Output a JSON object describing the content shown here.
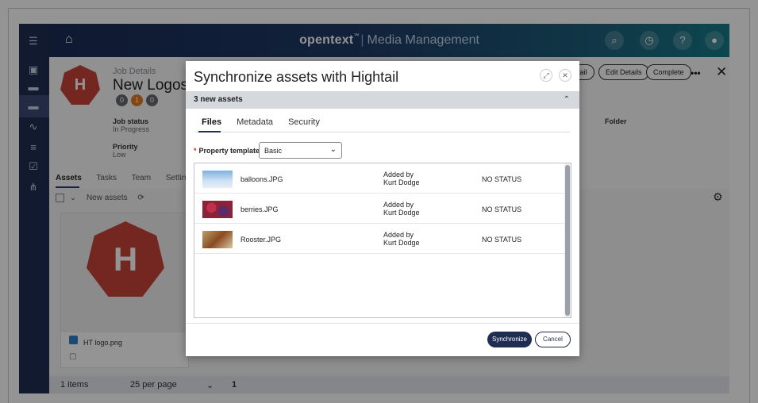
{
  "app": {
    "brand_name": "opentext",
    "brand_tm": "™",
    "brand_product": "Media Management"
  },
  "job": {
    "label": "Job Details",
    "title": "New Logos - F",
    "badges": [
      "0",
      "1",
      "0"
    ],
    "status_label": "Job status",
    "status_value": "In Progress",
    "priority_label": "Priority",
    "priority_value": "Low",
    "folder_label": "Folder",
    "header_buttons": [
      "tail",
      "Edit Details",
      "Complete"
    ],
    "more": "•••",
    "close": "✕"
  },
  "job_tabs": [
    "Assets",
    "Tasks",
    "Team",
    "Settings"
  ],
  "assets_toolbar": {
    "title": "New assets",
    "refresh": "⟳",
    "gear": "⚙"
  },
  "asset_card": {
    "name": "HT logo.png",
    "logo_letter": "H"
  },
  "pager": {
    "count": "1 items",
    "per_page": "25 per page",
    "page": "1"
  },
  "modal": {
    "title": "Synchronize assets with Hightail",
    "section_title": "3 new assets",
    "tabs": [
      "Files",
      "Metadata",
      "Security"
    ],
    "property_label": "Property template:",
    "property_required": "*",
    "property_value": "Basic",
    "files": [
      {
        "name": "balloons.JPG",
        "added_line1": "Added by",
        "added_line2": "Kurt Dodge",
        "status": "NO STATUS"
      },
      {
        "name": "berries.JPG",
        "added_line1": "Added by",
        "added_line2": "Kurt Dodge",
        "status": "NO STATUS"
      },
      {
        "name": "Rooster.JPG",
        "added_line1": "Added by",
        "added_line2": "Kurt Dodge",
        "status": "NO STATUS"
      }
    ],
    "sync_label": "Synchronize",
    "cancel_label": "Cancel"
  },
  "colors": {
    "rail": "#1f2d52",
    "accent_red": "#c9443a",
    "primary_button": "#1f2d52",
    "badge_orange": "#e07a1f",
    "badge_gray": "#666a70"
  }
}
